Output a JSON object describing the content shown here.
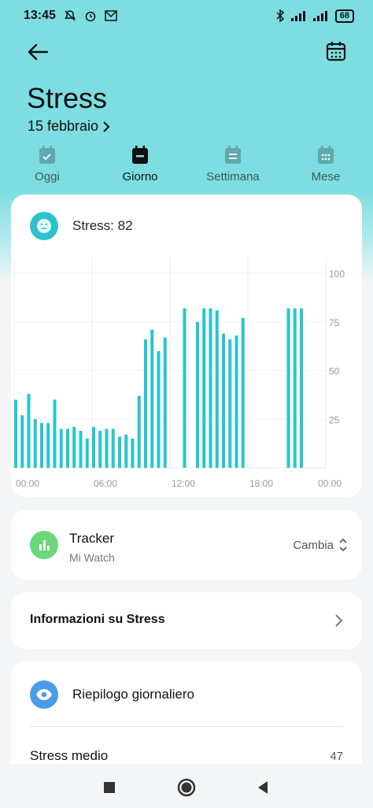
{
  "status_bar": {
    "time": "13:45",
    "battery": "68"
  },
  "header": {
    "title": "Stress",
    "date": "15 febbraio",
    "accent_color": "#7ddde0"
  },
  "tabs": [
    {
      "label": "Oggi",
      "icon": "calendar-check-icon",
      "active": false
    },
    {
      "label": "Giorno",
      "icon": "calendar-day-icon",
      "active": true
    },
    {
      "label": "Settimana",
      "icon": "calendar-week-icon",
      "active": false
    },
    {
      "label": "Mese",
      "icon": "calendar-month-icon",
      "active": false
    }
  ],
  "stress_card": {
    "label": "Stress: 82",
    "icon": "neutral-face-icon"
  },
  "chart_data": {
    "type": "bar",
    "x_tick_labels": [
      "00:00",
      "06:00",
      "12:00",
      "18:00",
      "00:00"
    ],
    "y_tick_labels": [
      "100",
      "75",
      "50",
      "25"
    ],
    "ylim": [
      0,
      100
    ],
    "xlim_hours": [
      0,
      24
    ],
    "grid": true,
    "bar_color": "#26c6cf",
    "bars": [
      {
        "hour": 0.0,
        "value": 35
      },
      {
        "hour": 0.5,
        "value": 27
      },
      {
        "hour": 1.0,
        "value": 38
      },
      {
        "hour": 1.5,
        "value": 25
      },
      {
        "hour": 2.0,
        "value": 23
      },
      {
        "hour": 2.5,
        "value": 23
      },
      {
        "hour": 3.0,
        "value": 35
      },
      {
        "hour": 3.5,
        "value": 20
      },
      {
        "hour": 4.0,
        "value": 20
      },
      {
        "hour": 4.5,
        "value": 21
      },
      {
        "hour": 5.0,
        "value": 19
      },
      {
        "hour": 5.5,
        "value": 15
      },
      {
        "hour": 6.0,
        "value": 21
      },
      {
        "hour": 6.5,
        "value": 19
      },
      {
        "hour": 7.0,
        "value": 20
      },
      {
        "hour": 7.5,
        "value": 20
      },
      {
        "hour": 8.0,
        "value": 16
      },
      {
        "hour": 8.5,
        "value": 17
      },
      {
        "hour": 9.0,
        "value": 15
      },
      {
        "hour": 9.5,
        "value": 37
      },
      {
        "hour": 10.0,
        "value": 66
      },
      {
        "hour": 10.5,
        "value": 71
      },
      {
        "hour": 11.0,
        "value": 60
      },
      {
        "hour": 11.5,
        "value": 67
      },
      {
        "hour": 13.0,
        "value": 82
      },
      {
        "hour": 14.0,
        "value": 75
      },
      {
        "hour": 14.5,
        "value": 82
      },
      {
        "hour": 15.0,
        "value": 82
      },
      {
        "hour": 15.5,
        "value": 81
      },
      {
        "hour": 16.0,
        "value": 69
      },
      {
        "hour": 16.5,
        "value": 66
      },
      {
        "hour": 17.0,
        "value": 68
      },
      {
        "hour": 17.5,
        "value": 77
      },
      {
        "hour": 21.0,
        "value": 82
      },
      {
        "hour": 21.5,
        "value": 82
      },
      {
        "hour": 22.0,
        "value": 82
      }
    ]
  },
  "tracker_card": {
    "title": "Tracker",
    "device": "Mi Watch",
    "action": "Cambia",
    "icon": "bar-chart-icon"
  },
  "info_card": {
    "label": "Informazioni su Stress",
    "icon": "chevron-right-icon"
  },
  "summary_card": {
    "title": "Riepilogo giornaliero",
    "icon": "eye-icon",
    "avg_label": "Stress medio",
    "avg_value": "47"
  }
}
